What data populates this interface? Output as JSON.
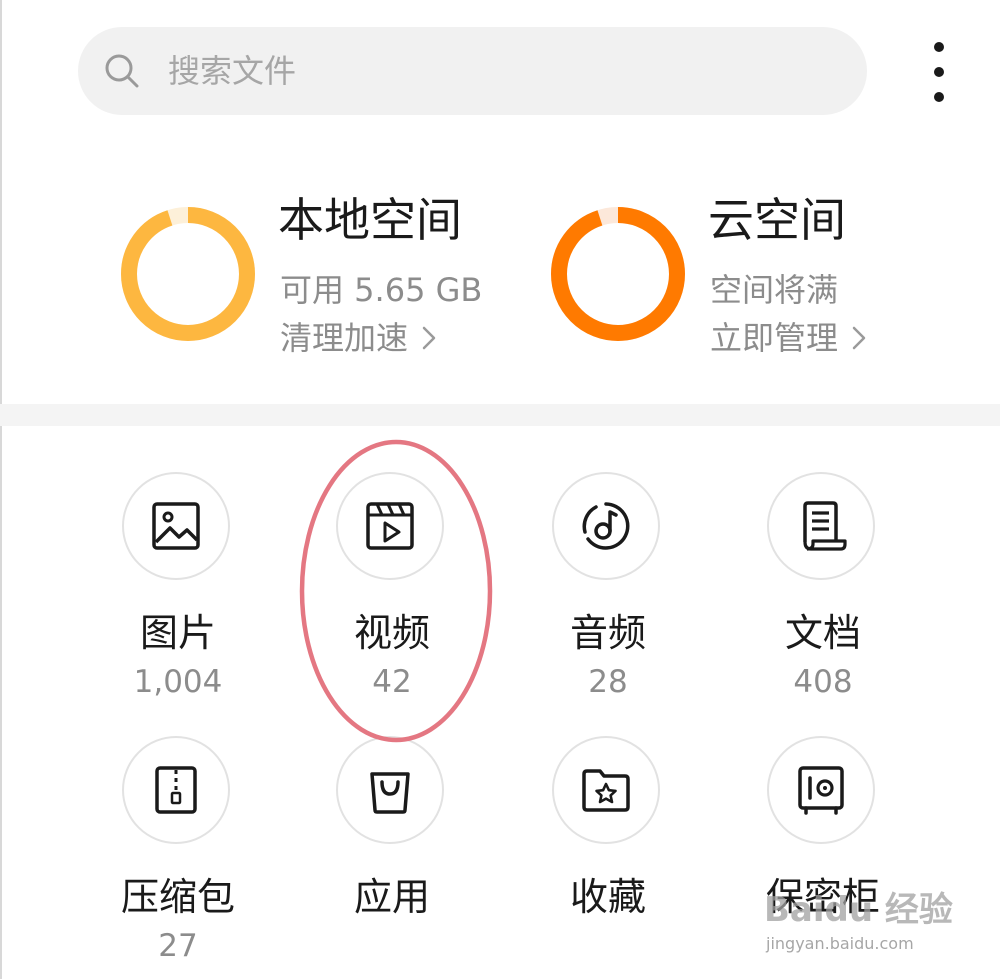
{
  "search": {
    "placeholder": "搜索文件"
  },
  "storage": {
    "local": {
      "title": "本地空间",
      "subtitle": "可用 5.65 GB",
      "action": "清理加速",
      "used_fraction": 0.95,
      "color": "#FDB740"
    },
    "cloud": {
      "title": "云空间",
      "subtitle": "空间将满",
      "action": "立即管理",
      "used_fraction": 0.95,
      "color": "#FF7A00"
    }
  },
  "categories": [
    {
      "label": "图片",
      "count": "1,004",
      "icon": "image-icon"
    },
    {
      "label": "视频",
      "count": "42",
      "icon": "video-icon"
    },
    {
      "label": "音频",
      "count": "28",
      "icon": "audio-icon"
    },
    {
      "label": "文档",
      "count": "408",
      "icon": "document-icon"
    },
    {
      "label": "压缩包",
      "count": "27",
      "icon": "archive-icon"
    },
    {
      "label": "应用",
      "count": "",
      "icon": "app-bag-icon"
    },
    {
      "label": "收藏",
      "count": "",
      "icon": "favorites-icon"
    },
    {
      "label": "保密柜",
      "count": "",
      "icon": "safe-icon"
    }
  ],
  "annotation": {
    "highlight_color": "#E47782"
  },
  "watermark": {
    "main": "Baidu 经验",
    "sub": "jingyan.baidu.com"
  }
}
